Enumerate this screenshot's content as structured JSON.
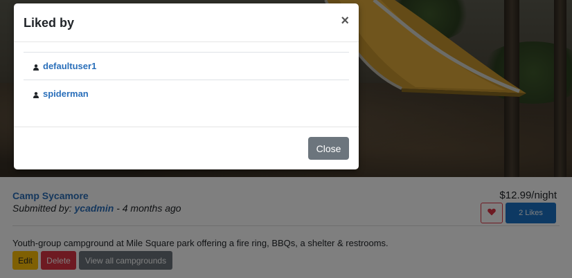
{
  "campground": {
    "name": "Camp Sycamore",
    "submitted_prefix": "Submitted by:",
    "author": "ycadmin",
    "time_ago": "- 4 months ago",
    "price": "$12.99/night",
    "likes_label": "2 Likes",
    "description": "Youth-group campground at Mile Square park offering a fire ring, BBQs, a shelter & restrooms.",
    "edit_label": "Edit",
    "delete_label": "Delete",
    "view_all_label": "View all campgrounds"
  },
  "modal": {
    "title": "Liked by",
    "close_symbol": "×",
    "users": [
      {
        "name": "defaultuser1",
        "icon": "user-icon"
      },
      {
        "name": "spiderman",
        "icon": "user-icon"
      }
    ],
    "close_label": "Close"
  },
  "colors": {
    "link": "#2a6fba",
    "likes_button": "#1a73c7",
    "heart": "#dc3545",
    "edit": "#ffc107",
    "delete": "#dc3545",
    "secondary": "#6c757d",
    "backdrop": "rgba(0,0,0,0.5)"
  }
}
